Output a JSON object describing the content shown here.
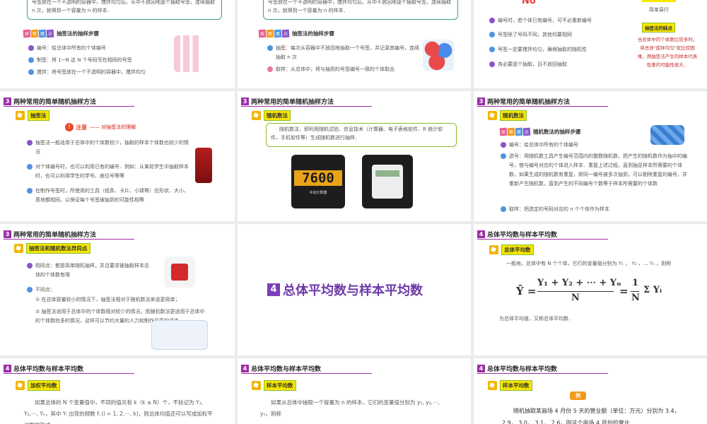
{
  "s1": {
    "box_text": "号签放在一个不透明的容器中，搅拌均匀后，从中不放回地逐个抽取号签，连续抽取 n 次，就得到一个容量为 n 的样本．",
    "explore": [
      "探",
      "索",
      "提",
      "示"
    ],
    "title": "抽签法的抽样步骤",
    "items": [
      "编号：给总体中所有的个体编号",
      "制签：将 1~N 这 N 个号码写在相同的号签",
      "搅拌：将号签放在一个不透明的容器中，搅拌均匀"
    ]
  },
  "s2": {
    "box_text": "号签放在一个不透明的容器中，搅拌均匀后，从中不放回地逐个抽取号签，连续抽取 n 次，就得到一个容量为 n 的样本．",
    "explore": [
      "探",
      "索",
      "提",
      "示"
    ],
    "title": "抽签法的抽样步骤",
    "items": [
      "抽签：每次从容器中不放回地抽取一个号签，并记录其编号，连续抽取 n 次",
      "取样：从总体中，将与抽到的号签编号一致的个体取出"
    ]
  },
  "s3": {
    "logo": "No",
    "tag1": "简单易行",
    "items": [
      "编号时，若个体已有编号，可不必重新编号",
      "号签除了号码不同，其他均要相同",
      "号签一定要搅拌均匀，确保抽取的随机性",
      "务必要逐个抽取，且不放回抽取"
    ],
    "tag2": "抽签法的缺点",
    "note": "当总体中的个体数比较多时，将总体\"搅拌均匀\"就比较困难，用抽签法产生的样本代表性差的可能性很大．"
  },
  "s4": {
    "num": "3",
    "header": "两种常用的简单随机抽样方法",
    "tag": "抽签法",
    "note_icon": "注意",
    "note_text": "—— 对抽签法的理解",
    "items": [
      "抽签法一般适用于总体中的个体数较少，抽取的样本个体数也较少的情况",
      "对个体编号时，也可以利用已有的编号．例如：从某班学生中抽取样本时，也可以利用学生的学号、座位号等等",
      "在制作号签时，所使用的工具（纸条、卡片、小球等）应形状、大小、质地都相同，以保证每个号签被抽到的可能性相等"
    ]
  },
  "s5": {
    "num": "3",
    "header": "两种常用的简单随机抽样方法",
    "tag": "随机数法",
    "text": "随机数法，即利用随机试验、信息技术（计算器、电子表格软件、R 统计软件、手机软件等）生成随机数进行抽样．",
    "counter": "7600",
    "counter_sub": "手动计数器"
  },
  "s6": {
    "num": "3",
    "header": "两种常用的简单随机抽样方法",
    "tag": "随机数法",
    "explore": [
      "探",
      "索",
      "提",
      "示"
    ],
    "title": "随机数法的抽样步骤",
    "items": [
      "编号：给总体中所有的个体编号",
      "选号：用随机数工具产生编号范围内的整数随机数，把产生的随机数作为抽中的编号，使与编号对应的个体进入样本．重复上述过程，直到抽足样本所需要的个体数，如果生成的随机数有重复，即同一编号被多次抽到，可以剔除重复的编号，并重新产生随机数，直到产生的不同编号个数等于样本所需要的个体数",
      "取样：把选定的号码对应的 n 个个体作为样本"
    ]
  },
  "s7": {
    "num": "3",
    "header": "两种常用的简单随机抽样方法",
    "tag": "抽签法和随机数法异同点",
    "items": [
      "相同点：都是简单随机抽样，并且要求被抽取样本总体的个体数有限",
      "不同点："
    ],
    "subitems": [
      "① 在总体容量较小的情况下，抽签法相对于随机数法来说更简单；",
      "② 抽签法适用于总体中的个体数相对较少的情况，而随机数法更适用于总体中的个体数较多的情况，这样可以节约大量的人力和制作号签的成本．"
    ]
  },
  "s8": {
    "num": "4",
    "title": "总体平均数与样本平均数"
  },
  "s9": {
    "num": "4",
    "header": "总体平均数与样本平均数",
    "tag": "总体平均数",
    "text1": "一般地，总体中有 N 个个体，它们的变量值分别为 Y₁ ， Y₂ ，… Yₙ ，则称",
    "f_lhs": "Ȳ =",
    "f_num": "Y₁ + Y₂ + ⋯ + Yₙ",
    "f_den": "N",
    "f_eq": "=",
    "f_coef_num": "1",
    "f_coef_den": "N",
    "f_sum": "Σ Yᵢ",
    "text2": "为总体平均值，又称总体平均数．"
  },
  "s10": {
    "num": "4",
    "header": "总体平均数与样本平均数",
    "tag": "加权平均数",
    "text": "如果总体的 N 个变量值中，不同的值共有 k（k ≤ N）个，不妨记为 Y₁, Y₂,⋯, Yₖ，其中 Yᵢ 出现的频数 fᵢ (i = 1, 2,⋯, k)，则总体均值还可以写成加权平均数的形式"
  },
  "s11": {
    "num": "4",
    "header": "总体平均数与样本平均数",
    "tag": "样本平均数",
    "text": "如果从总体中抽取一个容量为 n 的样本，它们的变量值分别为 y₁, y₂,⋯, yₙ，则称"
  },
  "s12": {
    "num": "4",
    "header": "总体平均数与样本平均数",
    "tag": "样本平均数",
    "badge": "例",
    "text": "随机抽取某商场 4 月份 5 天的营业额（单位：万元）分别为 3.4， 2.9， 3.0， 3.1， 2.6，则这个商场 4 月份的营业"
  }
}
